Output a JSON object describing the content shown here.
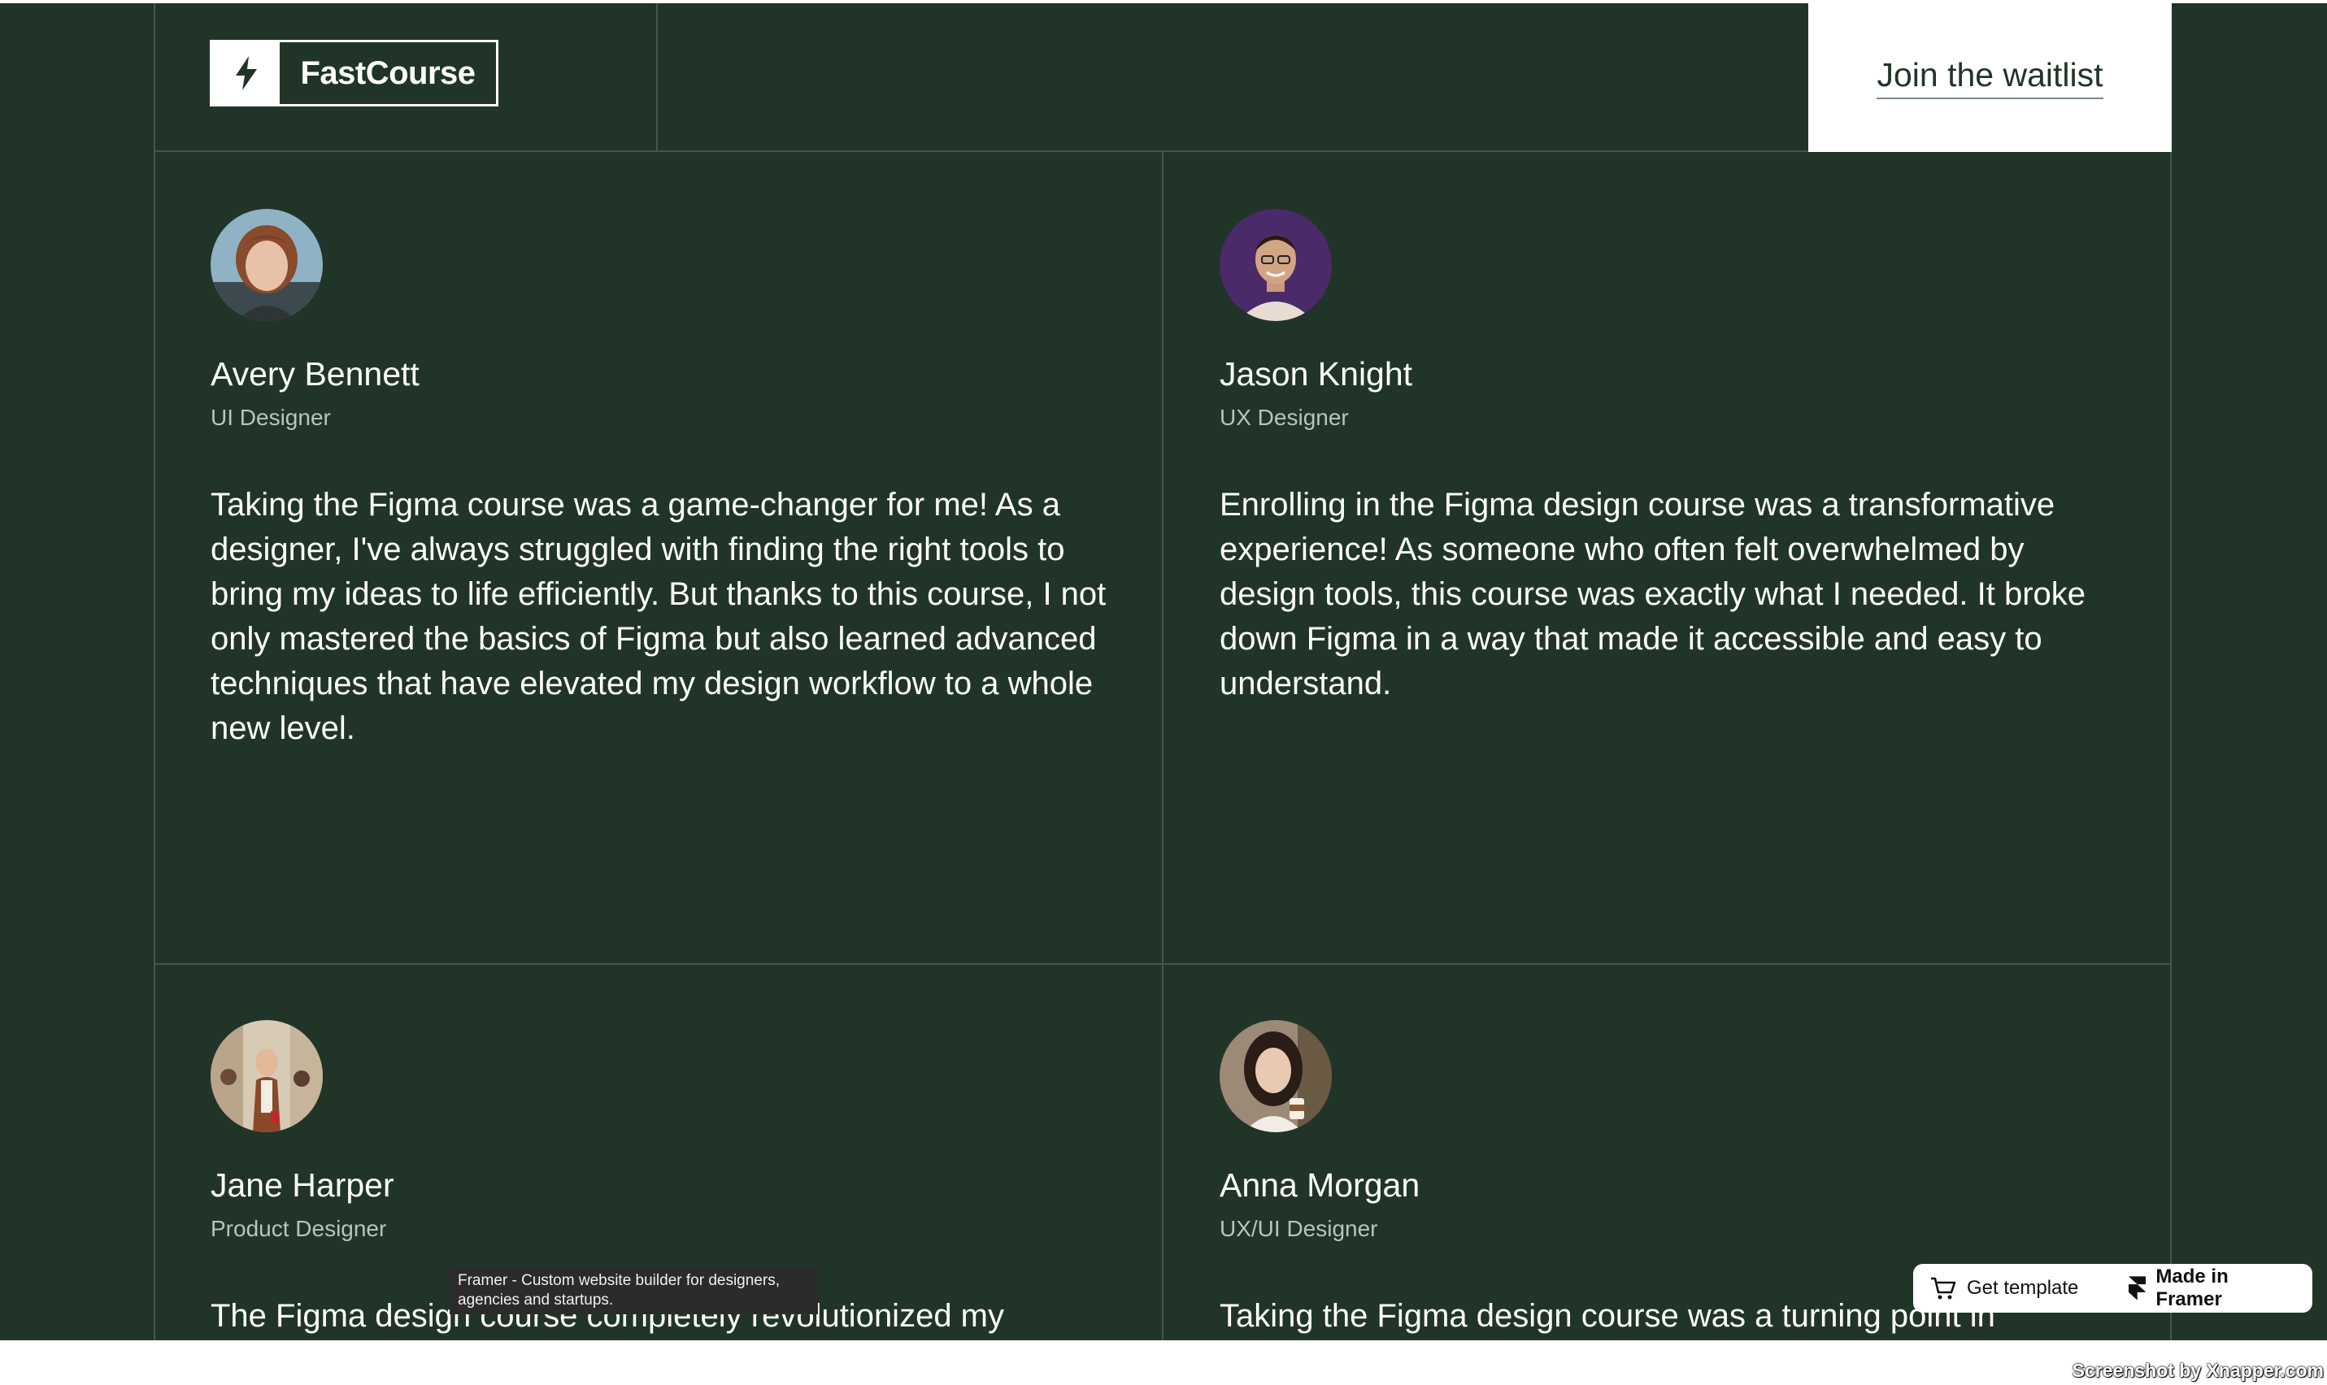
{
  "brand": {
    "name": "FastCourse",
    "icon": "bolt-icon"
  },
  "header": {
    "cta_label": "Join the waitlist"
  },
  "testimonials": [
    {
      "name": "Avery Bennett",
      "role": "UI Designer",
      "quote": "Taking the Figma course was a game-changer for me! As a designer, I've always struggled with finding the right tools to bring my ideas to life efficiently. But thanks to this course, I not only mastered the basics of Figma but also learned advanced techniques that have elevated my design workflow to a whole new level."
    },
    {
      "name": "Jason Knight",
      "role": "UX Designer",
      "quote": "Enrolling in the Figma design course was a transformative experience! As someone who often felt overwhelmed by design tools, this course was exactly what I needed. It broke down Figma in a way that made it accessible and easy to understand."
    },
    {
      "name": "Jane Harper",
      "role": "Product Designer",
      "quote": "The Figma design course completely revolutionized my"
    },
    {
      "name": "Anna Morgan",
      "role": "UX/UI Designer",
      "quote": "Taking the Figma design course was a turning point in"
    }
  ],
  "tooltip": {
    "text": "Framer - Custom website builder for designers, agencies and startups."
  },
  "badges": {
    "get_template": "Get template",
    "made_in_framer": "Made in Framer"
  },
  "watermark": "Screenshot by Xnapper.com",
  "colors": {
    "background": "#213428",
    "border": "#44574b",
    "cta_bg": "#ffffff",
    "text": "#ffffff",
    "muted": "#b8c4bc"
  }
}
